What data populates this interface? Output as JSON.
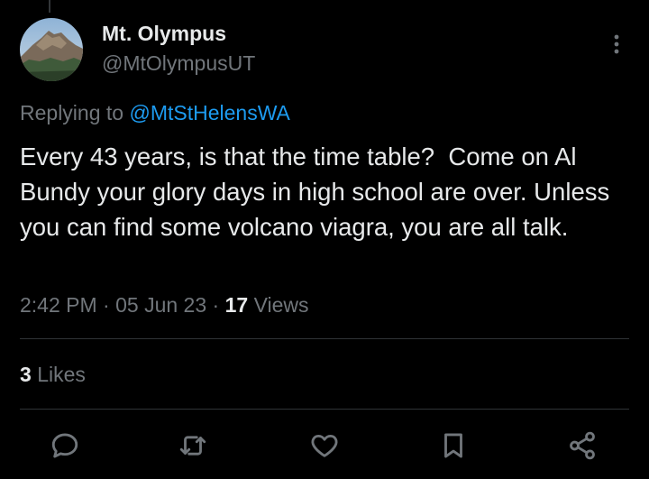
{
  "tweet": {
    "display_name": "Mt. Olympus",
    "handle": "@MtOlympusUT",
    "reply_prefix": "Replying to",
    "reply_mention": "@MtStHelensWA",
    "text": "Every 43 years, is that the time table?  Come on Al Bundy your glory days in high school are over. Unless you can find some volcano viagra, you are all talk.",
    "time": "2:42 PM",
    "separator": "·",
    "date": "05 Jun 23",
    "views_count": "17",
    "views_label": "Views",
    "likes_count": "3",
    "likes_label": "Likes"
  },
  "icons": {
    "more": "more-vertical-icon",
    "reply": "reply-icon",
    "retweet": "retweet-icon",
    "like": "heart-icon",
    "bookmark": "bookmark-icon",
    "share": "share-icon"
  },
  "colors": {
    "background": "#000000",
    "text": "#e7e9ea",
    "muted": "#71767b",
    "link": "#1d9bf0",
    "divider": "#2f3336"
  }
}
